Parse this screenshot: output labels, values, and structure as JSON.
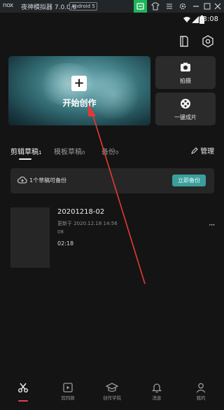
{
  "emulator": {
    "logo": "nox",
    "app_name": "夜神模拟器 7.0.0.6",
    "android_badge": "Android 5"
  },
  "status_bar": {
    "time": "3:08"
  },
  "hero": {
    "plus_symbol": "+",
    "label": "开始创作"
  },
  "side_cards": [
    {
      "label": "拍摄",
      "icon": "camera-icon"
    },
    {
      "label": "一键成片",
      "icon": "film-reel-icon"
    }
  ],
  "tabs": [
    {
      "label": "剪辑草稿",
      "count": "1"
    },
    {
      "label": "模板草稿",
      "count": "0"
    },
    {
      "label": "备份",
      "count": "0"
    }
  ],
  "manage_label": "管理",
  "backup": {
    "text": "1个草稿可备份",
    "button": "立即备份"
  },
  "draft": {
    "title": "20201218-02",
    "updated_line1": "更新于 2020.12.18 14:56",
    "updated_line2": "08",
    "duration": "02:18",
    "more": "···"
  },
  "bottom_nav": [
    {
      "label": "",
      "icon": "scissors-icon"
    },
    {
      "label": "剪同款",
      "icon": "template-icon"
    },
    {
      "label": "创作学院",
      "icon": "academy-icon"
    },
    {
      "label": "消息",
      "icon": "bell-icon"
    },
    {
      "label": "我的",
      "icon": "profile-icon"
    }
  ],
  "colors": {
    "accent_teal": "#3a9f9a",
    "nav_active": "#e0405a",
    "annotation_arrow": "#e53935"
  }
}
